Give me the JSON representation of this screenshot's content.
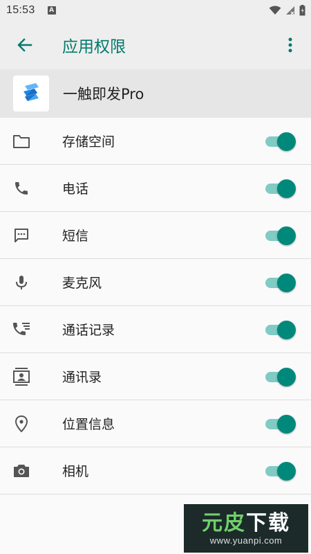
{
  "status_bar": {
    "time": "15:53",
    "notification_icon": "A"
  },
  "app_bar": {
    "title": "应用权限",
    "accent_color": "#00796b"
  },
  "app": {
    "name": "一触即发Pro"
  },
  "permissions": [
    {
      "label": "存储空间",
      "icon": "folder-icon",
      "enabled": true
    },
    {
      "label": "电话",
      "icon": "phone-icon",
      "enabled": true
    },
    {
      "label": "短信",
      "icon": "sms-icon",
      "enabled": true
    },
    {
      "label": "麦克风",
      "icon": "microphone-icon",
      "enabled": true
    },
    {
      "label": "通话记录",
      "icon": "call-log-icon",
      "enabled": true
    },
    {
      "label": "通讯录",
      "icon": "contacts-icon",
      "enabled": true
    },
    {
      "label": "位置信息",
      "icon": "location-icon",
      "enabled": true
    },
    {
      "label": "相机",
      "icon": "camera-icon",
      "enabled": true
    }
  ],
  "toggle_colors": {
    "thumb": "#00897b",
    "track": "#80cbc4"
  },
  "watermark": {
    "logo_part1": "元皮",
    "logo_part2": "下载",
    "url": "www.yuanpi.com"
  }
}
